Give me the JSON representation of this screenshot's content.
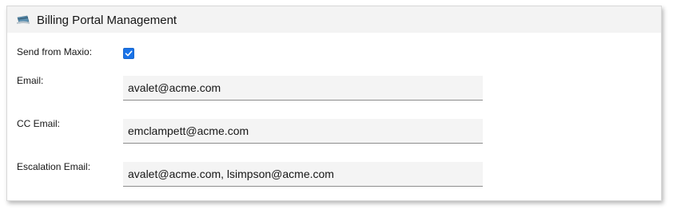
{
  "panel": {
    "title": "Billing Portal Management",
    "icon": "card-icon"
  },
  "form": {
    "send_from": {
      "label": "Send from Maxio:",
      "checked": true
    },
    "email": {
      "label": "Email:",
      "value": "avalet@acme.com"
    },
    "cc_email": {
      "label": "CC Email:",
      "value": "emclampett@acme.com"
    },
    "escalation_email": {
      "label": "Escalation Email:",
      "value": "avalet@acme.com, lsimpson@acme.com"
    }
  },
  "colors": {
    "header_bg": "#f3f3f3",
    "field_bg": "#f4f4f4",
    "checkbox": "#1a73e8"
  }
}
